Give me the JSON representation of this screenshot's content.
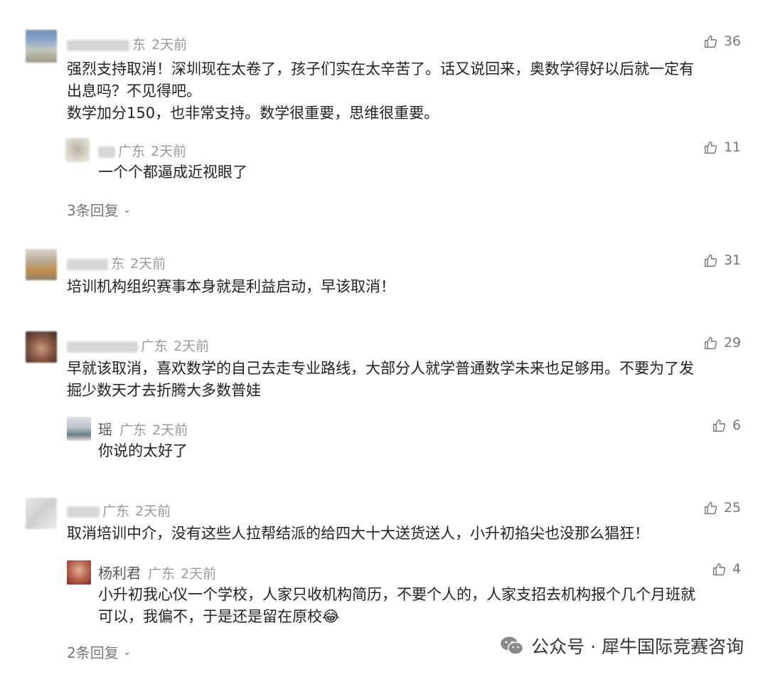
{
  "comments": [
    {
      "location": "东",
      "time": "2天前",
      "likes": "36",
      "text_lines": [
        "强烈支持取消！深圳现在太卷了，孩子们实在太辛苦了。话又说回来，奥数学得好以后就一定有",
        "出息吗？不见得吧。",
        "数学加分150，也非常支持。数学很重要，思维很重要。"
      ],
      "replies": [
        {
          "name": "",
          "location": "广东",
          "time": "2天前",
          "likes": "11",
          "text_lines": [
            "一个个都逼成近视眼了"
          ]
        }
      ],
      "more_replies": "3条回复"
    },
    {
      "location": "东",
      "time": "2天前",
      "likes": "31",
      "text_lines": [
        "培训机构组织赛事本身就是利益启动，早该取消！"
      ],
      "replies": [],
      "more_replies": ""
    },
    {
      "location": "广东",
      "time": "2天前",
      "likes": "29",
      "text_lines": [
        "早就该取消，喜欢数学的自己去走专业路线，大部分人就学普通数学未来也足够用。不要为了发",
        "掘少数天才去折腾大多数普娃"
      ],
      "replies": [
        {
          "name": "瑶",
          "location": "广东",
          "time": "2天前",
          "likes": "6",
          "text_lines": [
            "你说的太好了"
          ]
        }
      ],
      "more_replies": ""
    },
    {
      "location": "广东",
      "time": "2天前",
      "likes": "25",
      "text_lines": [
        "取消培训中介，没有这些人拉帮结派的给四大十大送货送人，小升初掐尖也没那么猖狂！"
      ],
      "replies": [
        {
          "name": "杨利君",
          "location": "广东",
          "time": "2天前",
          "likes": "4",
          "text_lines": [
            "小升初我心仪一个学校，人家只收机构简历，不要个人的，人家支招去机构报个几个月班就",
            "可以，我偏不，于是还是留在原校😂"
          ]
        }
      ],
      "more_replies": "2条回复"
    }
  ],
  "watermark": {
    "text": "公众号 · 犀牛国际竞赛咨询"
  },
  "colors": {
    "text": "#222222",
    "meta": "#999999",
    "like": "#777777"
  }
}
